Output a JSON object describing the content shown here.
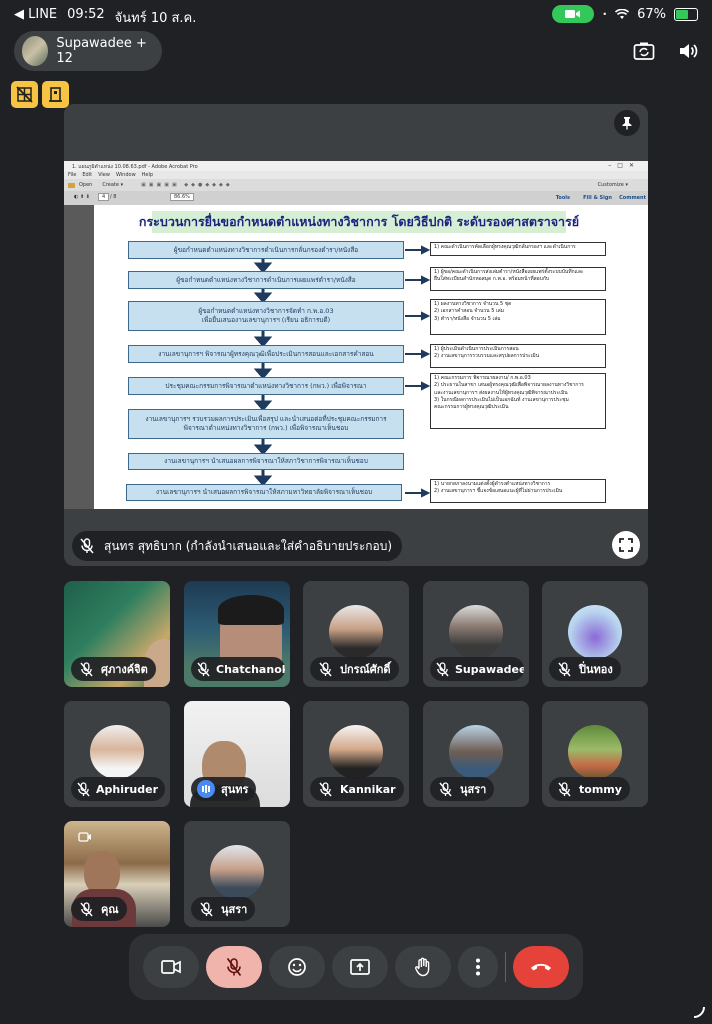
{
  "status_bar": {
    "back_app": "◀ LINE",
    "time": "09:52",
    "date": "จันทร์ 10 ส.ค.",
    "battery": "67%",
    "battery_level": 0.67
  },
  "header": {
    "title": "Supawadee + 12"
  },
  "presentation": {
    "presenter_label": "สุนทร สุทธิบาก (กำลังนำเสนอและใส่คำอธิบายประกอบ)",
    "slide": {
      "acrobat_title": "1. แผนภูมิตำแหน่ง 10.08.63.pdf - Adobe Acrobat Pro",
      "menu": [
        "File",
        "Edit",
        "View",
        "Window",
        "Help"
      ],
      "toolbar": [
        "Open",
        "Create ▾"
      ],
      "page_current": "4",
      "page_total": "/ 8",
      "zoom": "86.6%",
      "customize": "Customize ▾",
      "right_tabs": [
        "Tools",
        "Fill & Sign",
        "Comment"
      ],
      "title": "กระบวนการยื่นขอกำหนดตำแหน่งทางวิชาการ โดยวิธีปกติ ระดับรองศาสตราจารย์",
      "steps": [
        "ผู้ขอกำหนดตำแหน่งทางวิชาการดำเนินการกลั่นกรองตำรา/หนังสือ",
        "ผู้ขอกำหนดตำแหน่งทางวิชาการดำเนินการเผยแพร่ตำรา/หนังสือ",
        "ผู้ขอกำหนดตำแหน่งทางวิชาการจัดทำ ก.พ.อ.03\nเพื่อยื่นเสนองานเลขานุการฯ (เรียน อธิการบดี)",
        "งานเลขานุการฯ พิจารณาผู้ทรงคุณวุฒิเพื่อประเมินการสอนและเอกสารคำสอน",
        "ประชุมคณะกรรมการพิจารณาตำแหน่งทางวิชาการ (กพว.) เพื่อพิจารณา",
        "งานเลขานุการฯ รวบรวมผลการประเมินเพื่อสรุป และนำเสนอต่อที่ประชุมคณะกรรมการ\nพิจารณาตำแหน่งทางวิชาการ (กพว.) เพื่อพิจารณาเห็นชอบ",
        "งานเลขานุการฯ นำเสนอผลการพิจารณาให้สภาวิชาการพิจารณาเห็นชอบ",
        "งานเลขานุการฯ นำเสนอผลการพิจารณาให้สภามหาวิทยาลัยพิจารณาเห็นชอบ"
      ],
      "notes": [
        "1) คณะดำเนินการคัดเลือกผู้ทรงคุณวุฒิกลั่นกรองฯ และดำเนินการ",
        "1) ผู้ขอ/คณะดำเนินการส่งเล่มตำรา/หนังสือเผยแพร่ตั้งระบบบันทึกและ\nยื่นใส่ทะเบียนสำนักหอสมุด ก.พ.อ. พร้อมหน้าที่สอบกับ",
        "1) ผลงานทางวิชาการ จำนวน 5 ชุด\n2) เอกสารคำสอน จำนวน 5 เล่ม\n3) ตำรา/หนังสือ จำนวน 5 เล่ม",
        "1) ผู้ประเมินดำเนินการประเมินการสอน\n2) งานเลขานุการรวบรวมและสรุปผลการประเมิน",
        "1) คณะกรรมการ พิจารณาผลงาน/ ก.พ.อ.03\n2) ประธานในสาขา เสนอผู้ทรงคุณวุฒิเพื่อพิจารณาผลงานทางวิชาการ\nและงานเลขานุการฯ ส่งผลงานให้ผู้ทรงคุณวุฒิพิจารณาประเมิน\n3) ในกรณีผลการประเมินไม่เป็นเอกฉันท์ งานเลขานุการประชุม\nคณะกรรมการผู้ทรงคุณวุฒิประเมิน",
        "1) นายกสภาลงนามแต่งตั้งผู้ดำรงตำแหน่งทางวิชาการ\n2) งานเลขานุการฯ ชี้แจงข้อเสนอแนะผู้ที่ไม่ผ่านการประเมิน"
      ]
    }
  },
  "participants": [
    {
      "name": "ศุภางค์จิต",
      "muted": true
    },
    {
      "name": "Chatchanok",
      "muted": true
    },
    {
      "name": "ปกรณ์ศักดิ์",
      "muted": true
    },
    {
      "name": "Supawadee",
      "muted": true
    },
    {
      "name": "ปิ่นทอง",
      "muted": true
    },
    {
      "name": "Aphiruder",
      "muted": true
    },
    {
      "name": "สุนทร",
      "muted": false
    },
    {
      "name": "Kannikar",
      "muted": true
    },
    {
      "name": "นุสรา",
      "muted": true
    },
    {
      "name": "tommy",
      "muted": true
    },
    {
      "name": "คุณ",
      "muted": true
    },
    {
      "name": "นุสรา",
      "muted": true
    }
  ],
  "colors": {
    "background": "#202124",
    "tile": "#3c4043",
    "end_call": "#e5433a",
    "mic_off_active": "#f1b4ad",
    "accent_yellow": "#f6c343",
    "speaking_blue": "#4a8af4"
  },
  "icons": {
    "controls": [
      "camera-icon",
      "mic-off-icon",
      "emoji-icon",
      "present-icon",
      "raise-hand-icon",
      "more-icon",
      "end-call-icon"
    ]
  }
}
